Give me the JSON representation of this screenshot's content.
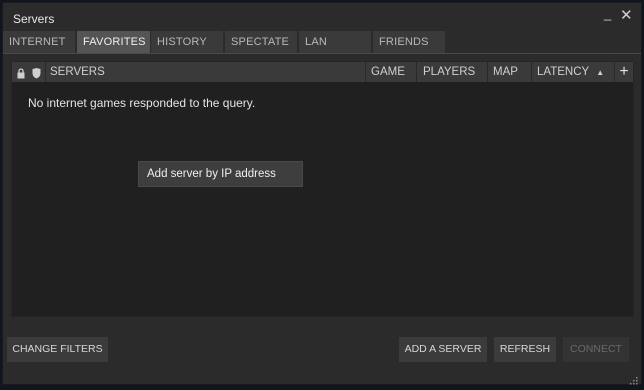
{
  "window": {
    "title": "Servers"
  },
  "titlebar": {
    "minimize_glyph": "_",
    "close_glyph": "✕"
  },
  "tabs": [
    {
      "label": "INTERNET",
      "active": false
    },
    {
      "label": "FAVORITES",
      "active": true
    },
    {
      "label": "HISTORY",
      "active": false
    },
    {
      "label": "SPECTATE",
      "active": false
    },
    {
      "label": "LAN",
      "active": false
    },
    {
      "label": "FRIENDS",
      "active": false
    }
  ],
  "columns": {
    "lock_icon": "lock-icon",
    "shield_icon": "shield-icon",
    "servers": "SERVERS",
    "game": "GAME",
    "players": "PLAYERS",
    "map": "MAP",
    "latency": "LATENCY",
    "latency_sort": "▲",
    "add": "+"
  },
  "list": {
    "empty_message": "No internet games responded to the query."
  },
  "context_menu": {
    "items": [
      {
        "label": "Add server by IP address"
      }
    ]
  },
  "buttons": {
    "change_filters": "CHANGE FILTERS",
    "add_server": "ADD A SERVER",
    "refresh": "REFRESH",
    "connect": "CONNECT"
  },
  "colors": {
    "window_bg": "#2b2b2b",
    "list_bg": "#202020",
    "header_bg": "#3a3a3a",
    "active_tab_bg": "#545454"
  }
}
